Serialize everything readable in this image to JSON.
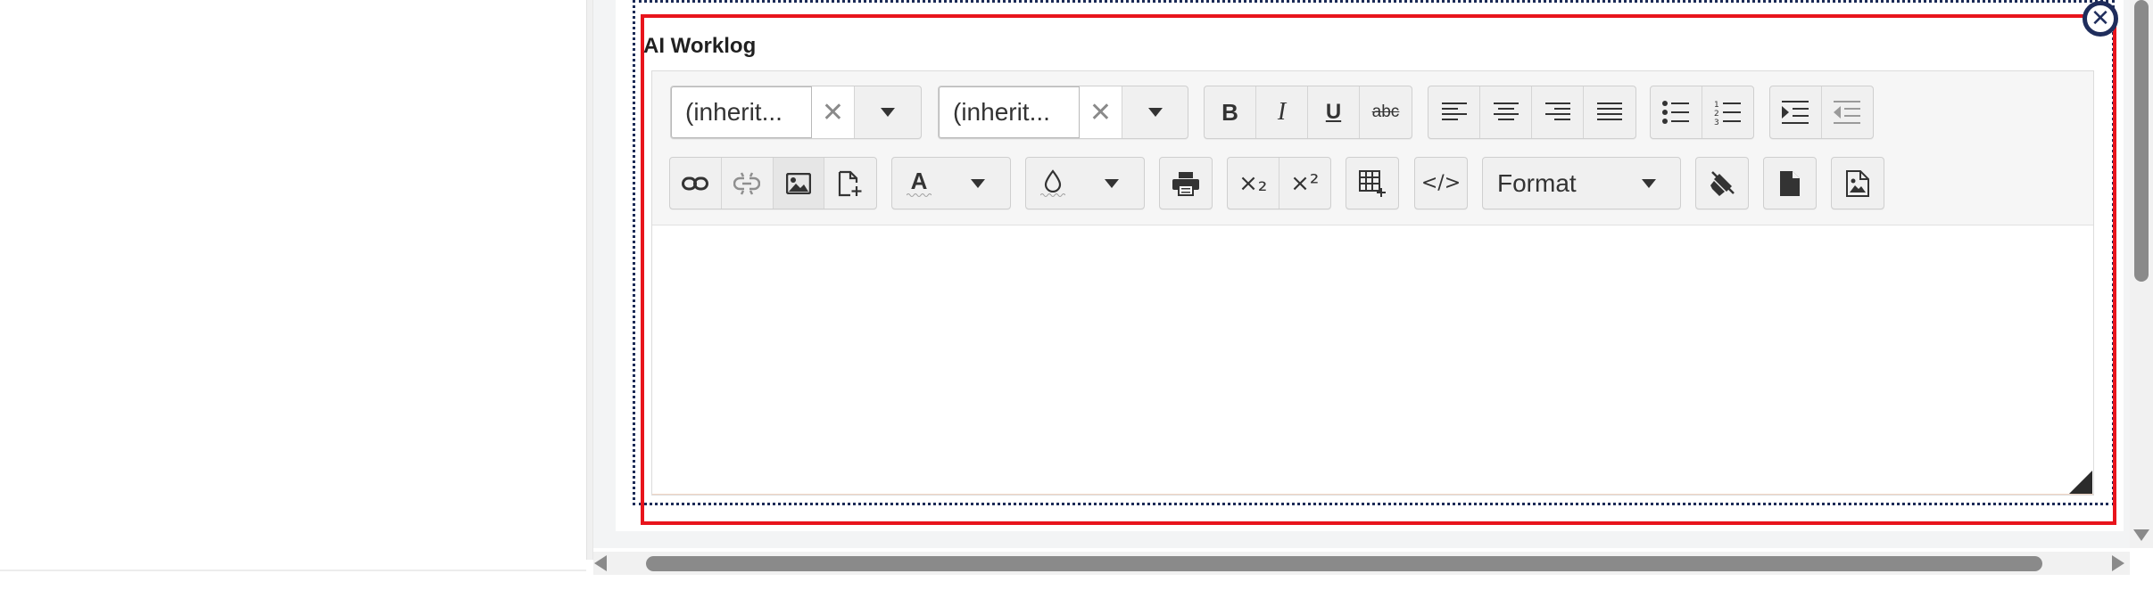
{
  "editor": {
    "label": "AI Worklog",
    "font_family_value": "(inherit...",
    "font_size_value": "(inherit...",
    "format_label": "Format",
    "content": ""
  },
  "toolbar": {
    "row1": [
      "font-family-combo",
      "font-size-combo",
      "bold",
      "italic",
      "underline",
      "strikethrough",
      "align-left",
      "align-center",
      "align-right",
      "align-justify",
      "bullet-list",
      "numbered-list",
      "indent",
      "outdent"
    ],
    "row2": [
      "link",
      "unlink",
      "insert-image",
      "insert-file",
      "text-color",
      "background-color",
      "print",
      "subscript",
      "superscript",
      "insert-table",
      "html-code",
      "format",
      "clear-formatting",
      "document",
      "image-document"
    ],
    "bold_glyph": "B",
    "italic_glyph": "I",
    "underline_glyph": "U",
    "strike_glyph": "abc",
    "text_color_glyph": "A",
    "subscript_glyph": "×₂",
    "superscript_glyph": "×²",
    "code_glyph": "</>",
    "clear_glyph": "✕"
  },
  "colors": {
    "highlight": "#e8141c",
    "dotted_frame": "#1c2b57",
    "close_badge": "#1f2d5c"
  },
  "scrollbars": {
    "horizontal": true,
    "vertical": true
  }
}
